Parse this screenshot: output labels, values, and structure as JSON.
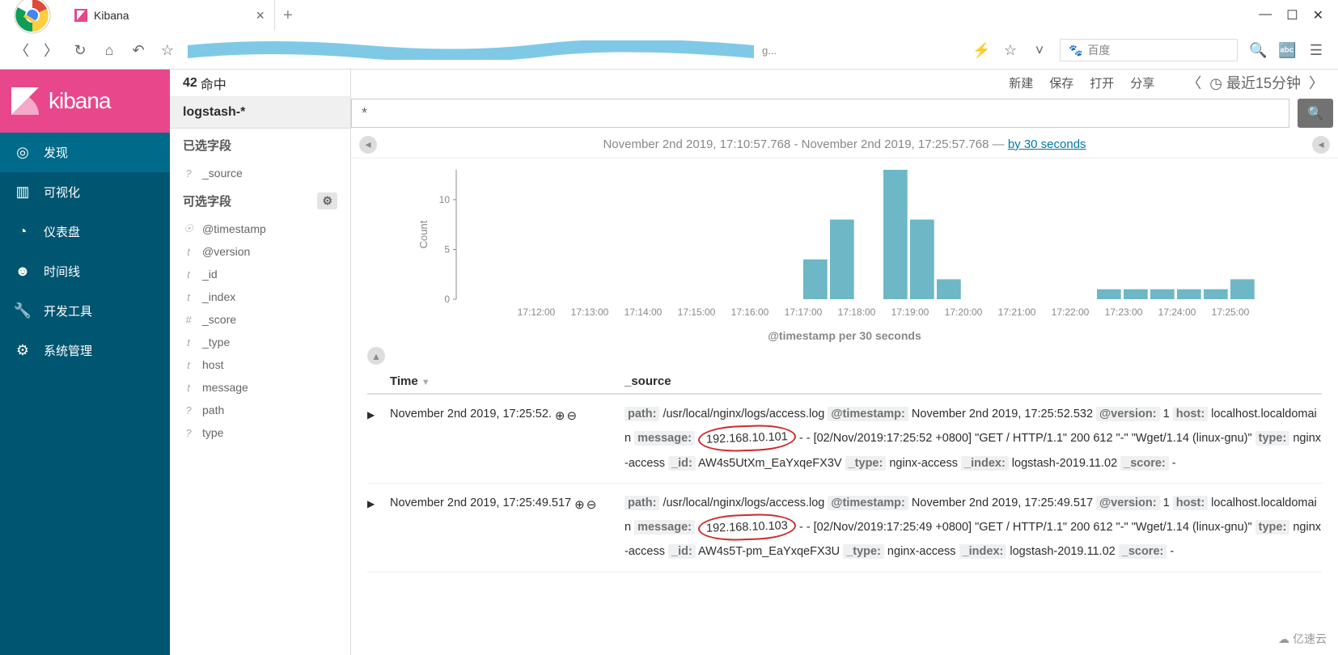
{
  "browser": {
    "tab_title": "Kibana",
    "url_snippet_left": "/app",
    "url_suffix": "g...",
    "search_engine": "百度",
    "win": {
      "min": "—",
      "max": "☐",
      "close": "✕"
    }
  },
  "brand": {
    "name": "kibana"
  },
  "nav": {
    "items": [
      {
        "label": "发现",
        "icon": "◎"
      },
      {
        "label": "可视化",
        "icon": "▥"
      },
      {
        "label": "仪表盘",
        "icon": "◔"
      },
      {
        "label": "时间线",
        "icon": "☻"
      },
      {
        "label": "开发工具",
        "icon": "🔧"
      },
      {
        "label": "系统管理",
        "icon": "⚙"
      }
    ]
  },
  "hits": {
    "count": "42",
    "label": "命中"
  },
  "index_pattern": "logstash-*",
  "fields": {
    "selected_title": "已选字段",
    "available_title": "可选字段",
    "selected": [
      {
        "t": "?",
        "name": "_source"
      }
    ],
    "available": [
      {
        "t": "☉",
        "name": "@timestamp"
      },
      {
        "t": "t",
        "name": "@version"
      },
      {
        "t": "t",
        "name": "_id"
      },
      {
        "t": "t",
        "name": "_index"
      },
      {
        "t": "#",
        "name": "_score"
      },
      {
        "t": "t",
        "name": "_type"
      },
      {
        "t": "t",
        "name": "host"
      },
      {
        "t": "t",
        "name": "message"
      },
      {
        "t": "?",
        "name": "path"
      },
      {
        "t": "?",
        "name": "type"
      }
    ]
  },
  "topbar": {
    "links": [
      "新建",
      "保存",
      "打开",
      "分享"
    ],
    "time_prefix": "◷ 最近15分钟"
  },
  "query": {
    "value": "*"
  },
  "chart_data": {
    "type": "bar",
    "title": "November 2nd 2019, 17:10:57.768 - November 2nd 2019, 17:25:57.768 — ",
    "interval_link": "by 30 seconds",
    "ylabel": "Count",
    "xlabel": "@timestamp per 30 seconds",
    "labeled_ticks": [
      "17:12:00",
      "17:13:00",
      "17:14:00",
      "17:15:00",
      "17:16:00",
      "17:17:00",
      "17:18:00",
      "17:19:00",
      "17:20:00",
      "17:21:00",
      "17:22:00",
      "17:23:00",
      "17:24:00",
      "17:25:00"
    ],
    "categories": [
      "17:17:30",
      "17:18:00",
      "17:18:30",
      "17:19:00",
      "17:19:30",
      "17:20:00",
      "17:23:00",
      "17:23:30",
      "17:24:00",
      "17:24:30",
      "17:25:00",
      "17:25:30"
    ],
    "values": [
      4,
      8,
      0,
      13,
      8,
      2,
      1,
      1,
      1,
      1,
      1,
      2
    ],
    "yticks": [
      0,
      5,
      10
    ]
  },
  "table": {
    "headers": {
      "time": "Time",
      "source": "_source"
    },
    "rows": [
      {
        "time": "November 2nd 2019, 17:25:52.",
        "kv": {
          "path": "/usr/local/nginx/logs/access.log",
          "timestamp": "November 2nd 2019, 17:25:52.532",
          "version": "1",
          "host": "localhost.localdomain",
          "message_ip": "192.168.10.101",
          "message_rest": " - - [02/Nov/2019:17:25:52 +0800] \"GET / HTTP/1.1\" 200 612 \"-\" \"Wget/1.14 (linux-gnu)\"",
          "type": "nginx-access",
          "id": "AW4s5UtXm_EaYxqeFX3V",
          "idx_type": "nginx-access",
          "index": "logstash-2019.11.02",
          "score": "-"
        }
      },
      {
        "time": "November 2nd 2019, 17:25:49.517",
        "kv": {
          "path": "/usr/local/nginx/logs/access.log",
          "timestamp": "November 2nd 2019, 17:25:49.517",
          "version": "1",
          "host": "localhost.localdomain",
          "message_ip": "192.168.10.103",
          "message_rest": " - - [02/Nov/2019:17:25:49 +0800] \"GET / HTTP/1.1\" 200 612 \"-\" \"Wget/1.14 (linux-gnu)\"",
          "type": "nginx-access",
          "id": "AW4s5T-pm_EaYxqeFX3U",
          "idx_type": "nginx-access",
          "index": "logstash-2019.11.02",
          "score": "-"
        }
      }
    ]
  },
  "kvlabels": {
    "path": "path:",
    "timestamp": "@timestamp:",
    "version": "@version:",
    "host": "host:",
    "message": "message:",
    "type": "type:",
    "id": "_id:",
    "idx_type": "_type:",
    "index": "_index:",
    "score": "_score:"
  },
  "watermark": "亿速云"
}
